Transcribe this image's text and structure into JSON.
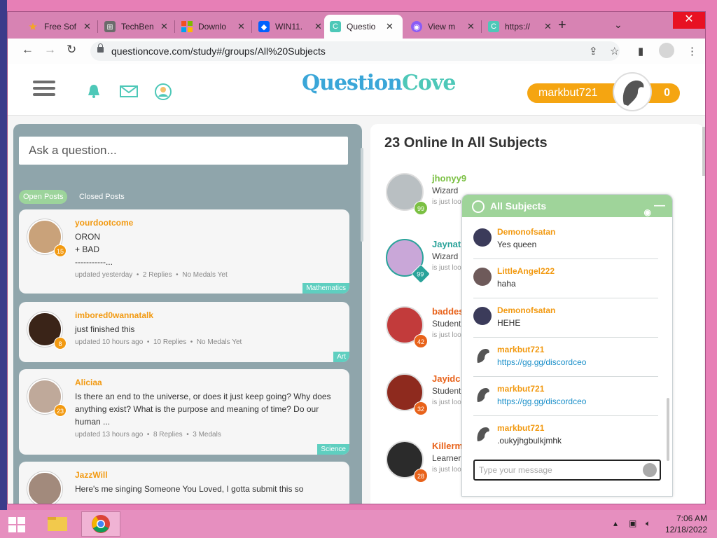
{
  "browser": {
    "tabs": [
      {
        "title": "Free Sof",
        "icon": "star-icon",
        "color": "#f5a623"
      },
      {
        "title": "TechBen",
        "icon": "windows-logo-icon",
        "color": "#555555"
      },
      {
        "title": "Downlo",
        "icon": "microsoft-logo-icon",
        "color": "#f25022"
      },
      {
        "title": "WIN11.",
        "icon": "dropbox-icon",
        "color": "#0061ff"
      },
      {
        "title": "Questio",
        "icon": "questioncove-icon",
        "color": "#4ec8b8"
      },
      {
        "title": "View m",
        "icon": "viewer-icon",
        "color": "#8a5cf6"
      },
      {
        "title": "https://",
        "icon": "questioncove-icon",
        "color": "#4ec8b8"
      }
    ],
    "url": "questioncove.com/study#/groups/All%20Subjects"
  },
  "site": {
    "logo_left": "Question",
    "logo_right": "Cove",
    "username": "markbut721",
    "points": "0"
  },
  "left": {
    "ask_placeholder": "Ask a question...",
    "tab_open": "Open Posts",
    "tab_closed": "Closed Posts",
    "posts": [
      {
        "user": "yourdootcome",
        "level": "15",
        "text": " ORON\n+  BAD\n-----------...",
        "updated": "updated yesterday",
        "replies": "2 Replies",
        "medals": "No Medals Yet",
        "tag": "Mathematics"
      },
      {
        "user": "imbored0wannatalk",
        "level": "8",
        "text": "just finished this",
        "updated": "updated 10 hours ago",
        "replies": "10 Replies",
        "medals": "No Medals Yet",
        "tag": "Art"
      },
      {
        "user": "Aliciaa",
        "level": "23",
        "text": "Is there an end to the universe, or does it just keep going? Why does anything exist? What is the purpose and meaning of time? Do our human ...",
        "updated": "updated 13 hours ago",
        "replies": "8 Replies",
        "medals": "3 Medals",
        "tag": "Science"
      },
      {
        "user": "JazzWill",
        "text": "Here's me singing Someone You Loved, I gotta submit this so"
      }
    ]
  },
  "right": {
    "title": "23 Online In All Subjects",
    "users": [
      {
        "name": "jhonyy9",
        "rank": "Wizard",
        "status": "is just loo",
        "level": "99",
        "color": "#7bc043"
      },
      {
        "name": "Jaynat",
        "rank": "Wizard",
        "status": "is just loo",
        "level": "99",
        "color": "#2aa39a"
      },
      {
        "name": "baddes",
        "rank": "Student",
        "status": "is just loo",
        "level": "42",
        "color": "#e8621a"
      },
      {
        "name": "Jayidc",
        "rank": "Student",
        "status": "is just loo",
        "level": "32",
        "color": "#e8621a"
      },
      {
        "name": "Killerm",
        "rank": "Learner",
        "status": "is just loo",
        "level": "28",
        "color": "#e8621a"
      }
    ]
  },
  "chat": {
    "title": "All Subjects",
    "messages": [
      {
        "user": "Demonofsatan",
        "text": "Yes queen"
      },
      {
        "user": "LittleAngel222",
        "text": "haha"
      },
      {
        "user": "Demonofsatan",
        "text": "HEHE"
      },
      {
        "user": "markbut721",
        "text": "https://gg.gg/discordceo"
      },
      {
        "user": "markbut721",
        "text": "https://gg.gg/discordceo"
      },
      {
        "user": "markbut721",
        "text": ".oukyjhgbulkjmhk"
      }
    ],
    "placeholder": "Type your message"
  },
  "taskbar": {
    "time": "7:06 AM",
    "date": "12/18/2022"
  }
}
